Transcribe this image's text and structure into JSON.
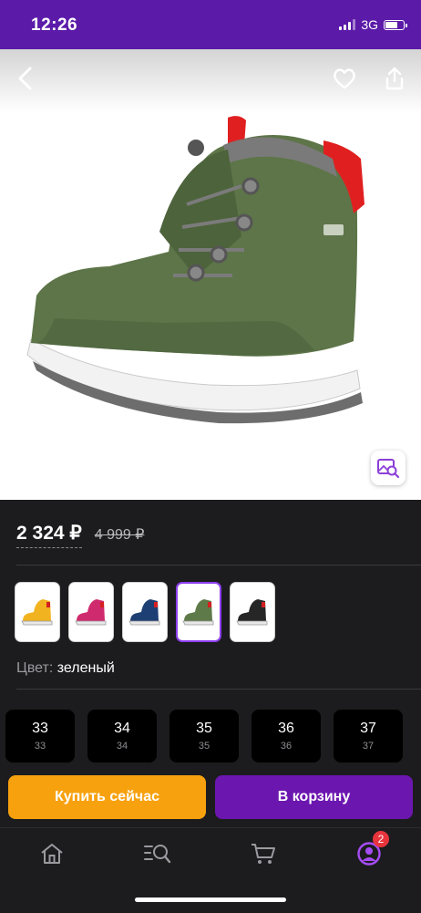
{
  "status_bar": {
    "time": "12:26",
    "network": "3G"
  },
  "product": {
    "price": "2 324 ₽",
    "old_price": "4 999 ₽",
    "color_label": "Цвет:",
    "color_value": "зеленый",
    "colors": [
      {
        "name": "yellow",
        "hex": "#f2b321"
      },
      {
        "name": "pink",
        "hex": "#d02a6e"
      },
      {
        "name": "navy",
        "hex": "#1e3f73"
      },
      {
        "name": "green",
        "hex": "#5e7a48",
        "selected": true
      },
      {
        "name": "black",
        "hex": "#262626"
      }
    ],
    "sizes": [
      {
        "main": "33",
        "sub": "33"
      },
      {
        "main": "34",
        "sub": "34"
      },
      {
        "main": "35",
        "sub": "35"
      },
      {
        "main": "36",
        "sub": "36"
      },
      {
        "main": "37",
        "sub": "37"
      }
    ]
  },
  "actions": {
    "buy_now": "Купить сейчас",
    "add_to_cart": "В корзину"
  },
  "tabbar": {
    "items": [
      {
        "icon": "home-icon"
      },
      {
        "icon": "catalog-search-icon"
      },
      {
        "icon": "cart-icon"
      },
      {
        "icon": "profile-icon",
        "badge": "2"
      }
    ]
  },
  "colors": {
    "accent": "#5b1aa8",
    "buy": "#f7a10e",
    "cart": "#6c16b0",
    "background": "#1c1c1e"
  }
}
